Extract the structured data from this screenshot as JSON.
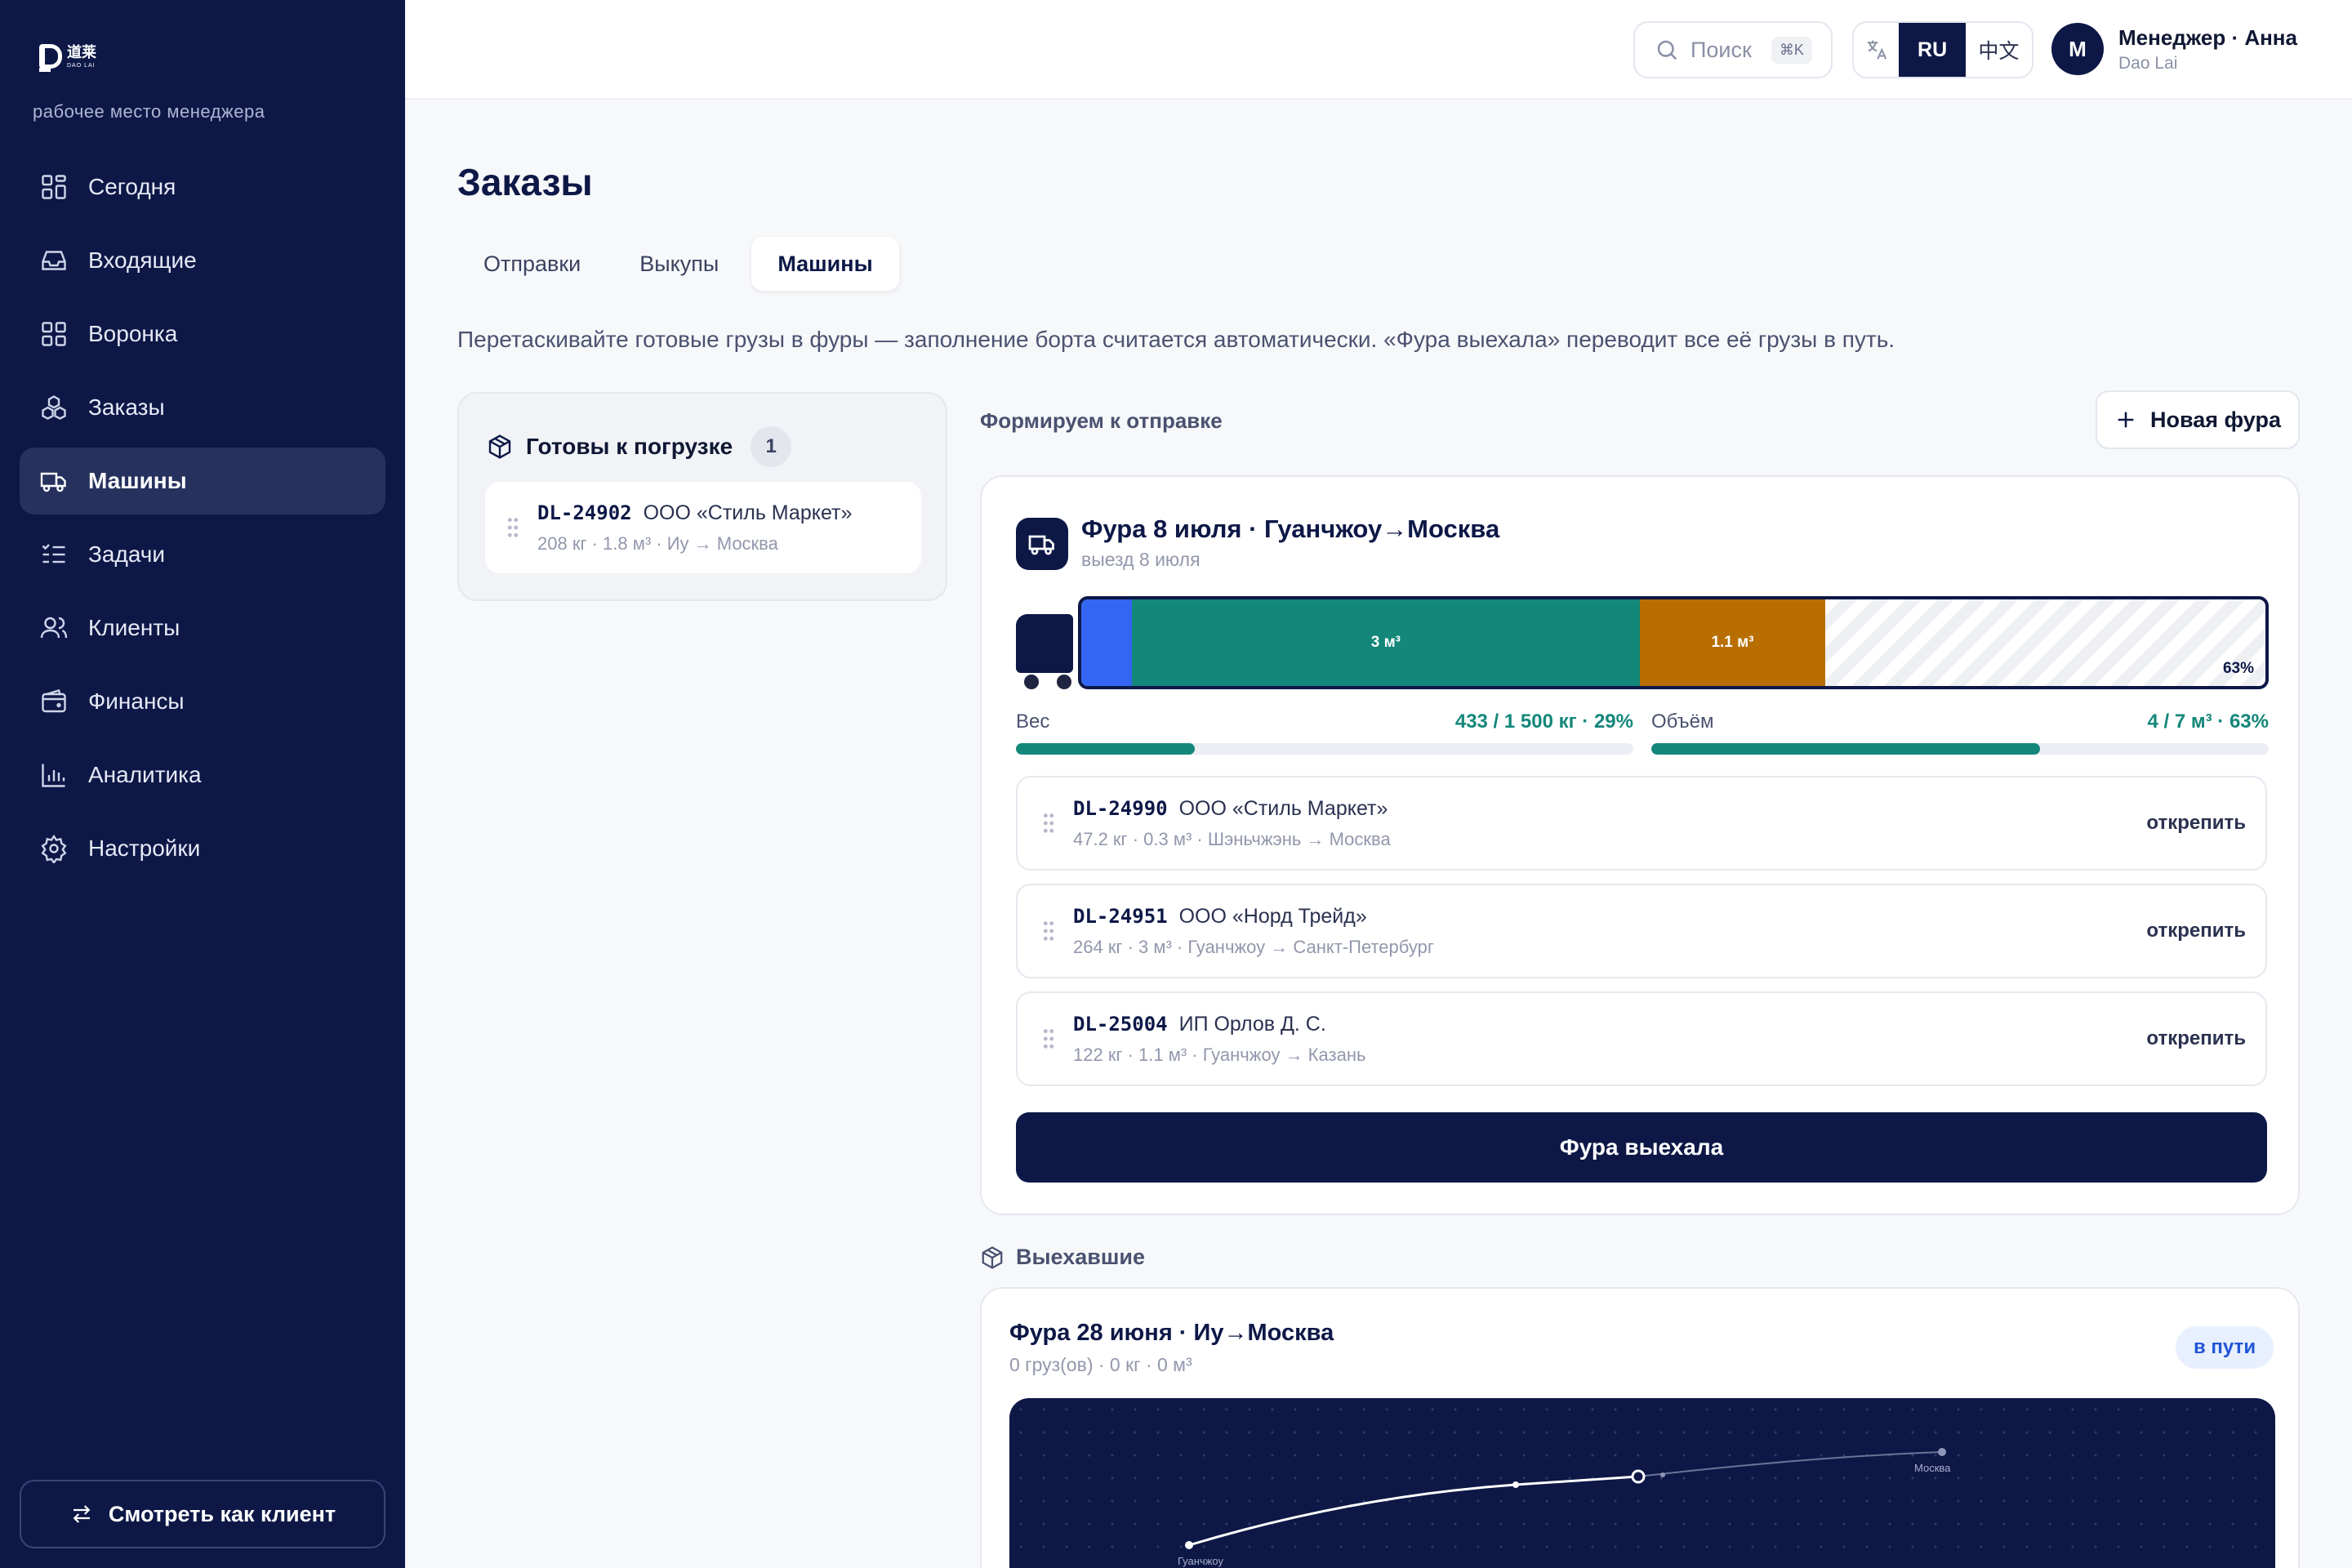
{
  "sidebar": {
    "logo_cn": "道莱",
    "logo_en": "DAO LAI",
    "workspace": "рабочее место менеджера",
    "items": [
      {
        "label": "Сегодня",
        "icon": "dashboard-icon"
      },
      {
        "label": "Входящие",
        "icon": "inbox-icon"
      },
      {
        "label": "Воронка",
        "icon": "funnel-grid-icon"
      },
      {
        "label": "Заказы",
        "icon": "boxes-icon"
      },
      {
        "label": "Машины",
        "icon": "truck-icon",
        "active": true
      },
      {
        "label": "Задачи",
        "icon": "tasks-icon"
      },
      {
        "label": "Клиенты",
        "icon": "users-icon"
      },
      {
        "label": "Финансы",
        "icon": "wallet-icon"
      },
      {
        "label": "Аналитика",
        "icon": "bar-chart-icon"
      },
      {
        "label": "Настройки",
        "icon": "gear-icon"
      }
    ],
    "client_view_label": "Смотреть как клиент"
  },
  "topbar": {
    "search_placeholder": "Поиск",
    "search_shortcut": "⌘K",
    "languages": [
      "RU",
      "中文"
    ],
    "active_language": "RU",
    "user_initial": "М",
    "user_name": "Менеджер · Анна",
    "user_company": "Dao Lai"
  },
  "page": {
    "title": "Заказы",
    "tabs": [
      {
        "label": "Отправки"
      },
      {
        "label": "Выкупы"
      },
      {
        "label": "Машины",
        "active": true
      }
    ],
    "hint": "Перетаскивайте готовые грузы в фуры — заполнение борта считается автоматически. «Фура выехала» переводит все её грузы в путь."
  },
  "ready": {
    "title": "Готовы к погрузке",
    "count": "1",
    "items": [
      {
        "id": "DL-24902",
        "client": "ООО «Стиль Маркет»",
        "details": "208 кг · 1.8 м³ · Иу → Москва"
      }
    ]
  },
  "forming": {
    "title": "Формируем к отправке",
    "new_truck_label": "Новая фура",
    "truck": {
      "title": "Фура 8 июля · Гуанчжоу→Москва",
      "subtitle": "выезд 8 июля",
      "capacity_m3": 7,
      "segments": [
        {
          "volume": 0.3,
          "label": "",
          "color": "#3366f2"
        },
        {
          "volume": 3,
          "label": "3 м³",
          "color": "#13877a"
        },
        {
          "volume": 1.1,
          "label": "1.1 м³",
          "color": "#b86e00"
        }
      ],
      "fill_percent_label": "63%",
      "weight": {
        "label": "Вес",
        "value_label": "433 / 1 500 кг · 29%",
        "fraction": 0.29
      },
      "volume": {
        "label": "Объём",
        "value_label": "4 / 7 м³ · 63%",
        "fraction": 0.63
      },
      "cargo": [
        {
          "id": "DL-24990",
          "client": "ООО «Стиль Маркет»",
          "details": "47.2 кг · 0.3 м³ · Шэньчжэнь → Москва",
          "action": "открепить"
        },
        {
          "id": "DL-24951",
          "client": "ООО «Норд Трейд»",
          "details": "264 кг · 3 м³ · Гуанчжоу → Санкт-Петербург",
          "action": "открепить"
        },
        {
          "id": "DL-25004",
          "client": "ИП Орлов Д. С.",
          "details": "122 кг · 1.1 м³ · Гуанчжоу → Казань",
          "action": "открепить"
        }
      ],
      "depart_label": "Фура выехала"
    }
  },
  "departed": {
    "title": "Выехавшие",
    "truck": {
      "title": "Фура 28 июня · Иу→Москва",
      "subtitle": "0 груз(ов) · 0 кг · 0 м³",
      "status": "в пути",
      "route_from": "Гуанчжоу",
      "route_to": "Москва"
    }
  }
}
